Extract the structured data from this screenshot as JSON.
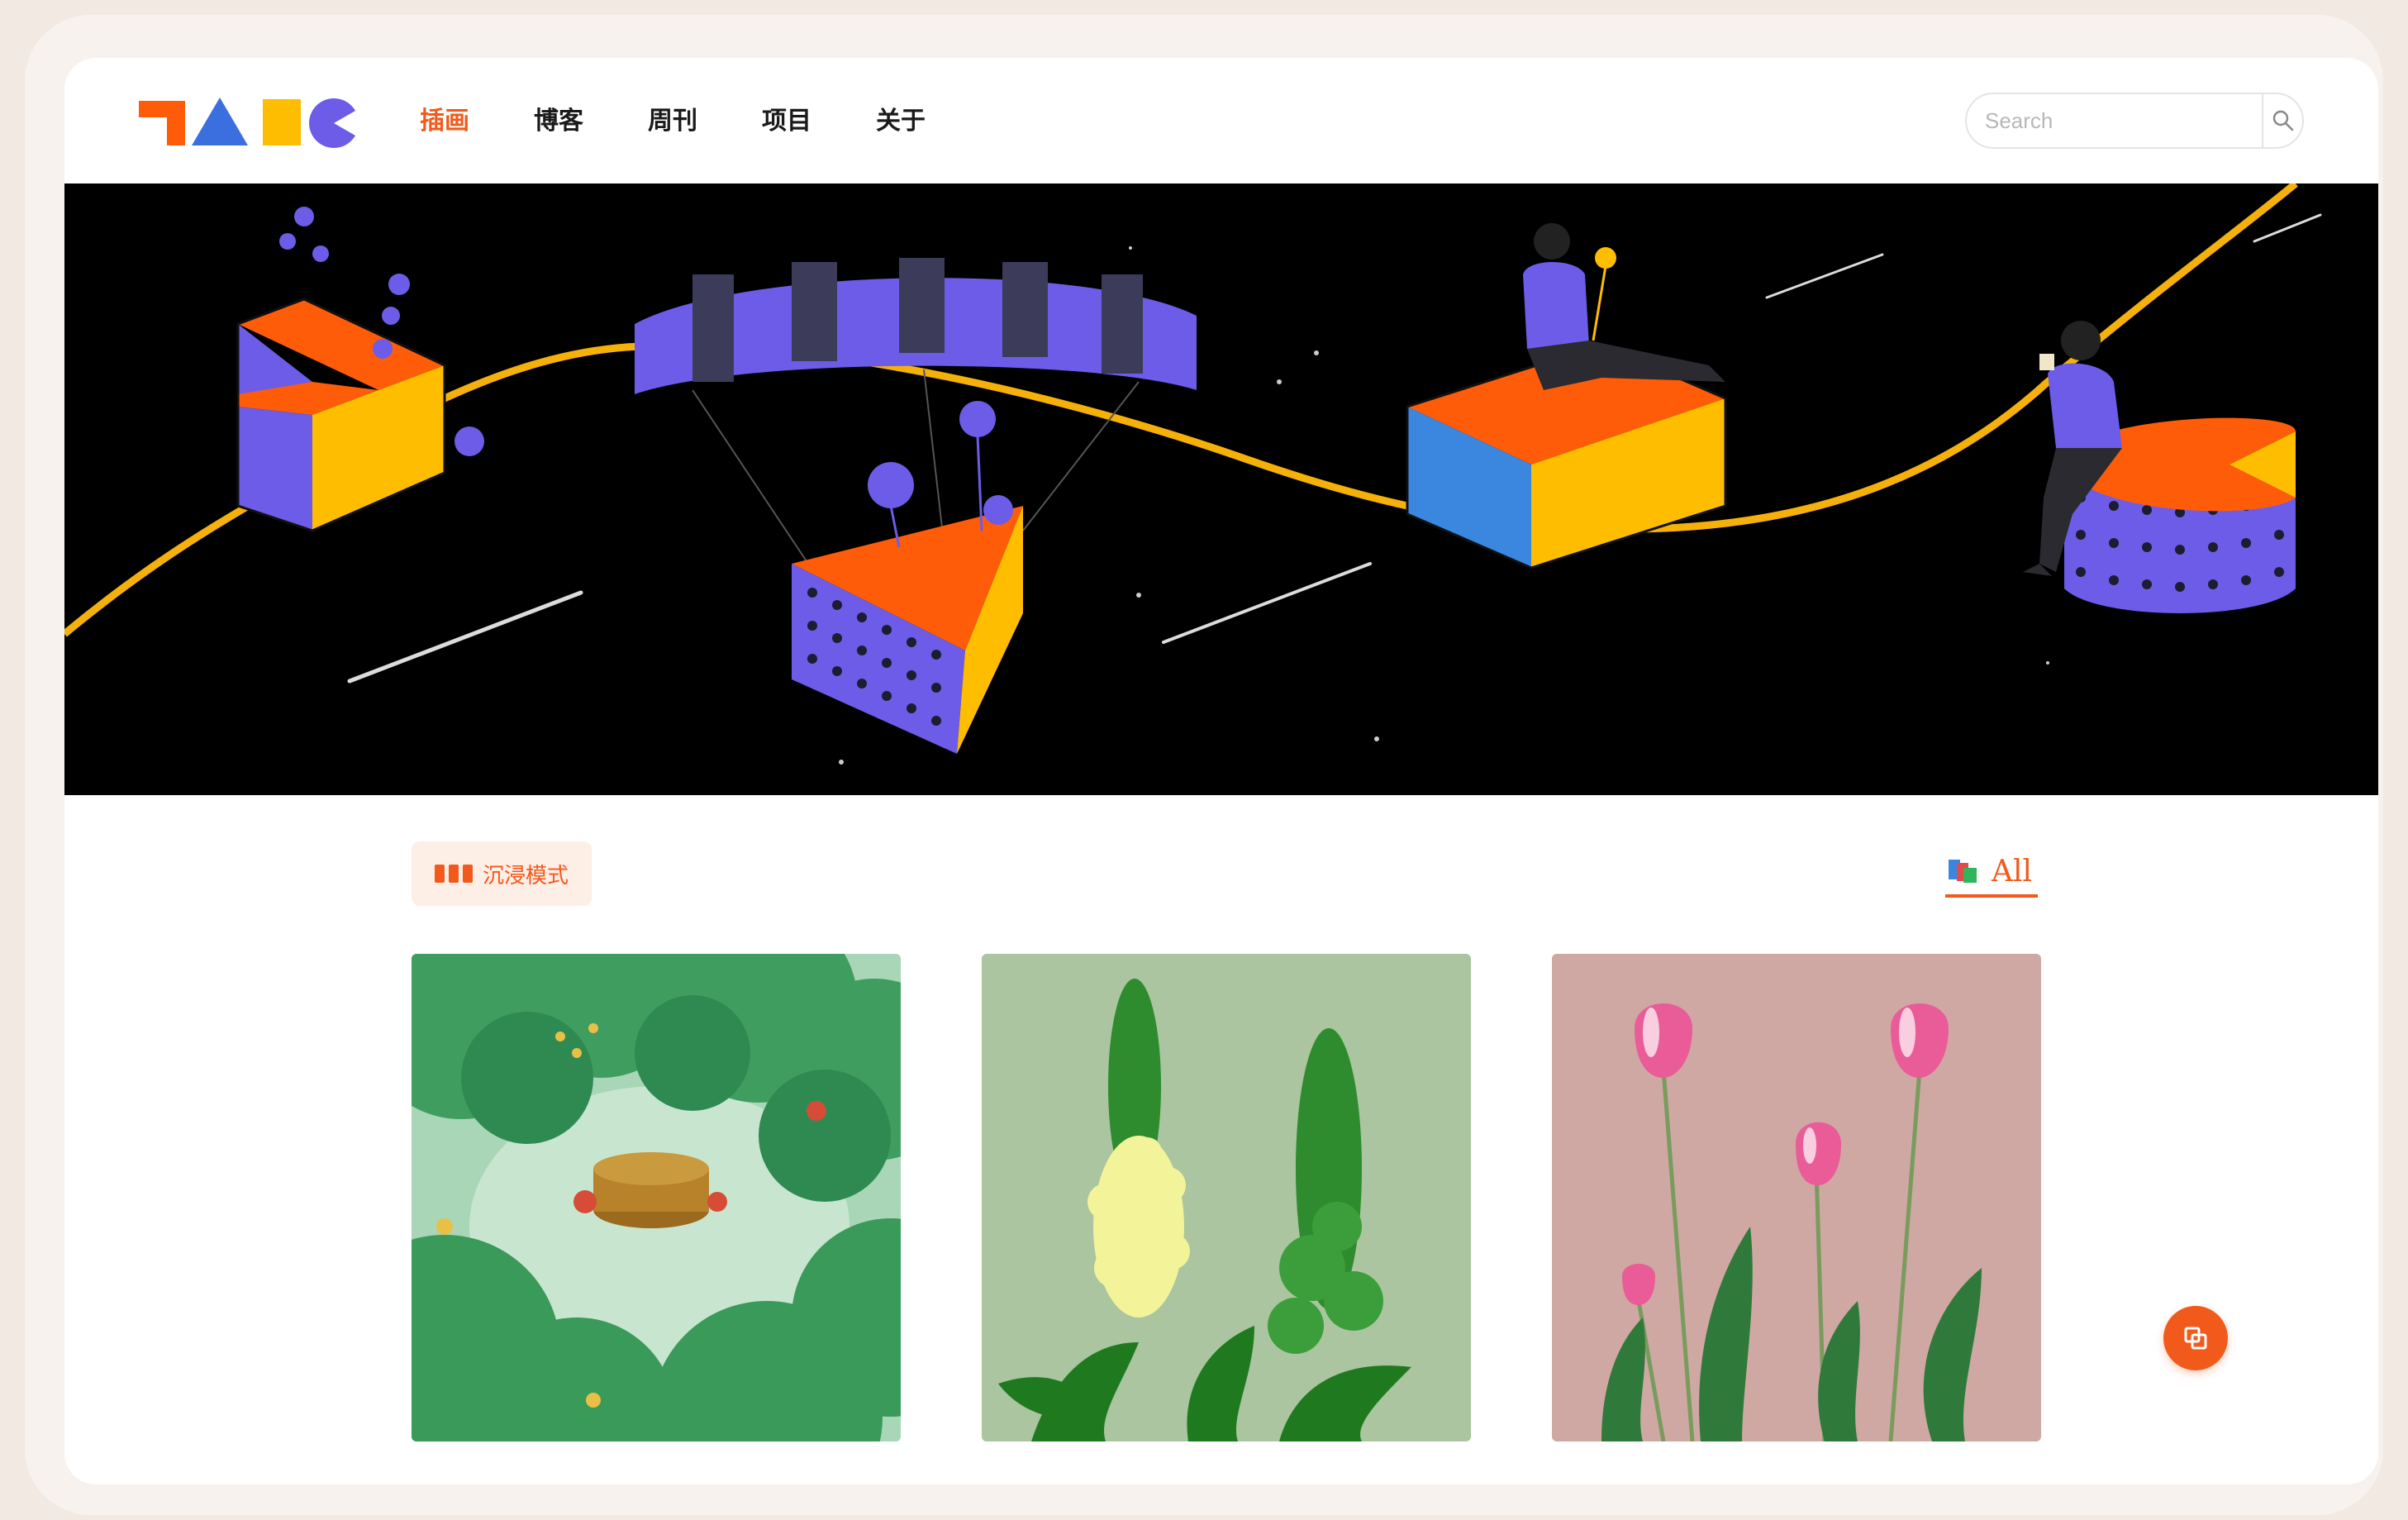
{
  "nav": {
    "items": [
      {
        "label": "插画",
        "active": true
      },
      {
        "label": "博客",
        "active": false
      },
      {
        "label": "周刊",
        "active": false
      },
      {
        "label": "项目",
        "active": false
      },
      {
        "label": "关于",
        "active": false
      }
    ]
  },
  "search": {
    "placeholder": "Search",
    "icon": "search-icon"
  },
  "toolbar": {
    "mode_label": "沉浸模式",
    "filter_label": "All",
    "filter_icon": "books-icon"
  },
  "gallery": {
    "items": [
      {
        "name": "forest-clearing-illustration"
      },
      {
        "name": "snapdragon-flowers-illustration"
      },
      {
        "name": "pink-tulips-illustration"
      }
    ]
  },
  "fab": {
    "icon": "layers-icon"
  },
  "colors": {
    "accent": "#f25a1c",
    "orange": "#ff5c0a",
    "blue": "#3b6fe0",
    "yellow": "#ffbd00",
    "purple": "#6c5ce7",
    "banner_bg": "#000000"
  }
}
